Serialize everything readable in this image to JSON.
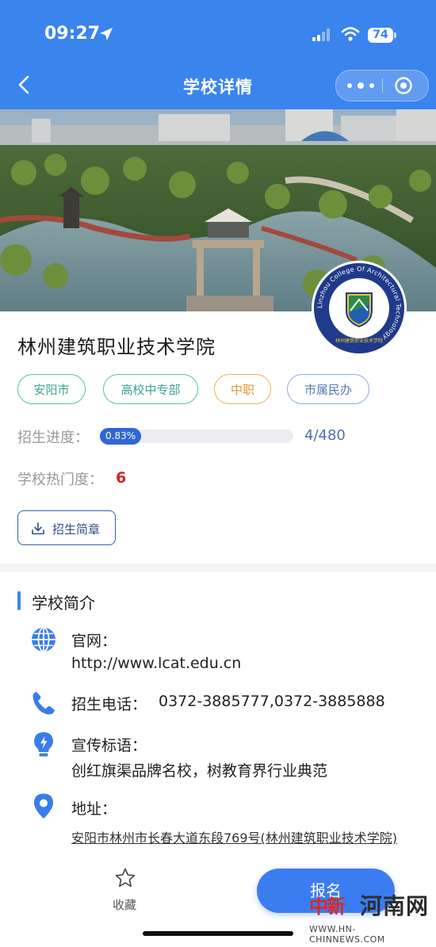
{
  "status_bar": {
    "time": "09:27",
    "battery": "74"
  },
  "nav": {
    "title": "学校详情"
  },
  "logo": {
    "ring_text": "Linzhou College Of Architectural Technology",
    "inner_text": "林州建筑职业技术学院"
  },
  "school": {
    "name": "林州建筑职业技术学院",
    "tags": [
      {
        "label": "安阳市",
        "color": "#3aa597"
      },
      {
        "label": "高校中专部",
        "color": "#3aa597"
      },
      {
        "label": "中职",
        "color": "#e99733"
      },
      {
        "label": "市属民办",
        "color": "#5679b4"
      }
    ],
    "progress": {
      "label": "招生进度：",
      "percent_text": "0.83%",
      "fraction": 0.0083,
      "count": "4/480"
    },
    "popularity": {
      "label": "学校热门度：",
      "value": "6"
    },
    "brochure_label": "招生简章"
  },
  "intro": {
    "section_title": "学校简介",
    "website_label": "官网：",
    "website_value": "http://www.lcat.edu.cn",
    "phone_label": "招生电话：",
    "phone_value": "0372-3885777,0372-3885888",
    "slogan_label": "宣传标语：",
    "slogan_value": "创红旗渠品牌名校，树教育界行业典范",
    "address_label": "地址：",
    "address_value": "安阳市林州市长春大道东段769号(林州建筑职业技术学院)"
  },
  "bottom_bar": {
    "favorite_label": "收藏",
    "apply_label": "报名"
  },
  "watermark": {
    "brand_red": "中新",
    "brand_black": "河南网",
    "url": "WWW.HN-CHINNEWS.COM"
  },
  "colors": {
    "header_blue": "#3a84ee",
    "accent_blue": "#2f67d6",
    "heat_red": "#d12626"
  }
}
